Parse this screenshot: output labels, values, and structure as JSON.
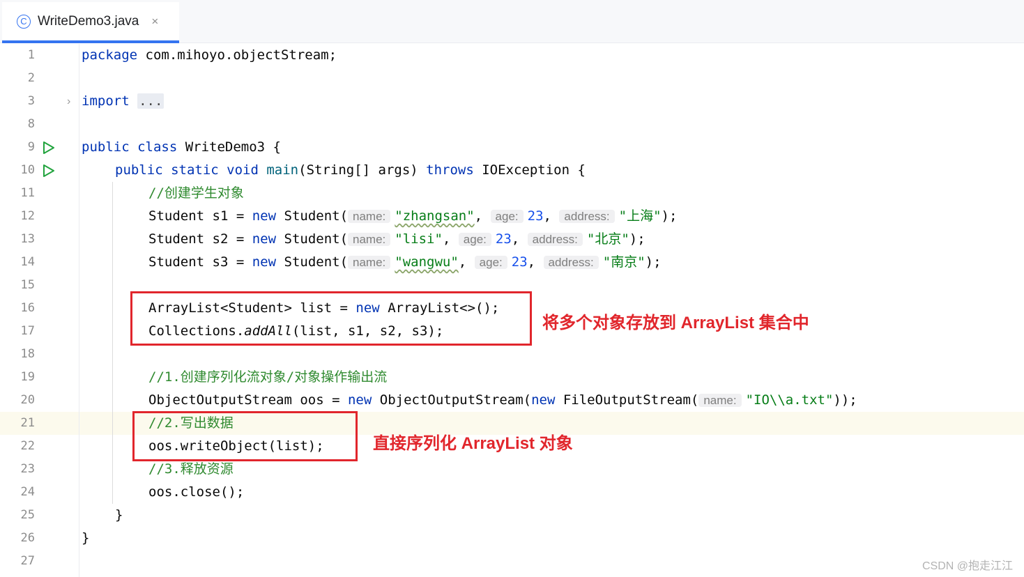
{
  "tab": {
    "icon_letter": "C",
    "title": "WriteDemo3.java",
    "close_glyph": "×"
  },
  "lines": [
    {
      "n": "1"
    },
    {
      "n": "2"
    },
    {
      "n": "3"
    },
    {
      "n": "8"
    },
    {
      "n": "9"
    },
    {
      "n": "10"
    },
    {
      "n": "11"
    },
    {
      "n": "12"
    },
    {
      "n": "13"
    },
    {
      "n": "14"
    },
    {
      "n": "15"
    },
    {
      "n": "16"
    },
    {
      "n": "17"
    },
    {
      "n": "18"
    },
    {
      "n": "19"
    },
    {
      "n": "20"
    },
    {
      "n": "21"
    },
    {
      "n": "22"
    },
    {
      "n": "23"
    },
    {
      "n": "24"
    },
    {
      "n": "25"
    },
    {
      "n": "26"
    },
    {
      "n": "27"
    }
  ],
  "code": {
    "l1_kw": "package",
    "l1_rest": " com.mihoyo.objectStream;",
    "l3_kw": "import",
    "l3_fold": "...",
    "l9_kw": "public class",
    "l9_rest": " WriteDemo3 {",
    "l10_kw1": "public static void",
    "l10_meth": "main",
    "l10_mid": "(String[] args) ",
    "l10_kw2": "throws",
    "l10_rest": " IOException {",
    "l11_cmt": "//创建学生对象",
    "student_prefix": "Student ",
    "eq_new": " = ",
    "new_kw": "new",
    "student_ctor": " Student(",
    "hint_name": "name:",
    "hint_age": "age:",
    "hint_address": "address:",
    "s1_var": "s1",
    "s1_name": "\"zhangsan\"",
    "s1_age": "23",
    "s1_addr": "\"上海\"",
    "s2_var": "s2",
    "s2_name": "\"lisi\"",
    "s2_age": "23",
    "s2_addr": "\"北京\"",
    "s3_var": "s3",
    "s3_name": "\"wangwu\"",
    "s3_age": "23",
    "s3_addr": "\"南京\"",
    "comma": ", ",
    "close_paren": ");",
    "l16_pre": "ArrayList<Student> list = ",
    "l16_post": " ArrayList<>();",
    "l17_pre": "Collections.",
    "l17_meth": "addAll",
    "l17_post": "(list, s1, s2, s3);",
    "l19_cmt": "//1.创建序列化流对象/对象操作输出流",
    "l20_pre": "ObjectOutputStream oos = ",
    "l20_mid": " ObjectOutputStream(",
    "l20_mid2": " FileOutputStream(",
    "l20_str": "\"IO\\\\a.txt\"",
    "l20_post": "));",
    "l21_cmt": "//2.写出数据",
    "l22_pre": "oos.",
    "l22_meth": "writeObject",
    "l22_post": "(list);",
    "l23_cmt": "//3.释放资源",
    "l24_pre": "oos.",
    "l24_meth": "close",
    "l24_post": "();",
    "brace": "}"
  },
  "annotations": {
    "box1_label": "将多个对象存放到 ArrayList 集合中",
    "box2_label": "直接序列化 ArrayList 对象"
  },
  "watermark": "CSDN @抱走江江",
  "colors": {
    "keyword": "#0033b3",
    "string": "#067d17",
    "number": "#1750eb",
    "comment": "#2f8a2f",
    "annotation_red": "#e1262c",
    "run_green": "#21a33d"
  }
}
